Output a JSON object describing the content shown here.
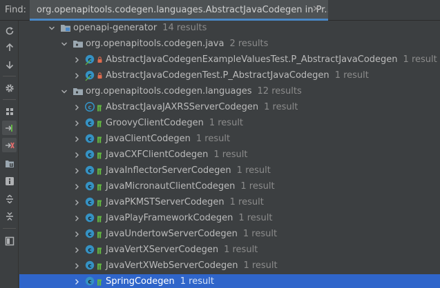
{
  "find_label": "Find:",
  "find_tab": {
    "title": "org.openapitools.codegen.languages.AbstractJavaCodegen in Pr...",
    "close_glyph": "✕"
  },
  "toolbar": [
    "rerun-icon",
    "previous-occurrence-icon",
    "next-occurrence-icon",
    "settings-icon",
    "group-by-icon",
    "navigate-from-source-icon",
    "navigate-to-source-icon",
    "preview-icon",
    "info-icon",
    "expand-all-icon",
    "collapse-all-icon",
    "pin-icon"
  ],
  "tree": [
    {
      "label": "openapi-generator",
      "count": "14 results",
      "kind": "module",
      "expanded": true
    },
    {
      "label": "org.openapitools.codegen.java",
      "count": "2 results",
      "kind": "package",
      "expanded": true
    },
    {
      "label": "AbstractJavaCodegenExampleValuesTest.P_AbstractJavaCodegen",
      "count": "1 result",
      "kind": "test-class",
      "expanded": false
    },
    {
      "label": "AbstractJavaCodegenTest.P_AbstractJavaCodegen",
      "count": "1 result",
      "kind": "test-class",
      "expanded": false
    },
    {
      "label": "org.openapitools.codegen.languages",
      "count": "12 results",
      "kind": "package",
      "expanded": true
    },
    {
      "label": "AbstractJavaJAXRSServerCodegen",
      "count": "1 result",
      "kind": "abstract-class",
      "expanded": false
    },
    {
      "label": "GroovyClientCodegen",
      "count": "1 result",
      "kind": "class",
      "expanded": false
    },
    {
      "label": "JavaClientCodegen",
      "count": "1 result",
      "kind": "class",
      "expanded": false
    },
    {
      "label": "JavaCXFClientCodegen",
      "count": "1 result",
      "kind": "class",
      "expanded": false
    },
    {
      "label": "JavaInflectorServerCodegen",
      "count": "1 result",
      "kind": "class",
      "expanded": false
    },
    {
      "label": "JavaMicronautClientCodegen",
      "count": "1 result",
      "kind": "class",
      "expanded": false
    },
    {
      "label": "JavaPKMSTServerCodegen",
      "count": "1 result",
      "kind": "class",
      "expanded": false
    },
    {
      "label": "JavaPlayFrameworkCodegen",
      "count": "1 result",
      "kind": "class",
      "expanded": false
    },
    {
      "label": "JavaUndertowServerCodegen",
      "count": "1 result",
      "kind": "class",
      "expanded": false
    },
    {
      "label": "JavaVertXServerCodegen",
      "count": "1 result",
      "kind": "class",
      "expanded": false
    },
    {
      "label": "JavaVertXWebServerCodegen",
      "count": "1 result",
      "kind": "class",
      "expanded": false
    },
    {
      "label": "SpringCodegen",
      "count": "1 result",
      "kind": "class",
      "expanded": false,
      "selected": true
    }
  ],
  "colors": {
    "background": "#3c3f41",
    "selection": "#2f65ca",
    "class_icon": "#3592c4",
    "access_public": "#62b543",
    "access_private": "#e06c4f",
    "folder": "#9aa7b0"
  }
}
